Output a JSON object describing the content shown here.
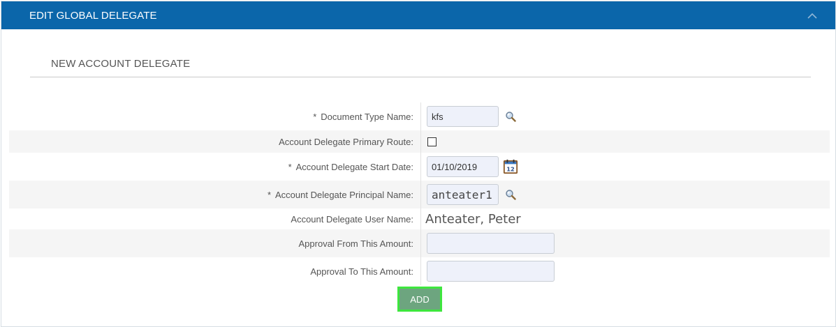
{
  "panel": {
    "title": "EDIT GLOBAL DELEGATE",
    "collapse_icon": "chevron-up-icon"
  },
  "section": {
    "title": "NEW ACCOUNT DELEGATE"
  },
  "fields": {
    "document_type": {
      "required_mark": "*",
      "label": "Document Type Name:",
      "value": "kfs",
      "lookup_icon": "search-icon"
    },
    "primary_route": {
      "label": "Account Delegate Primary Route:",
      "checked": false
    },
    "start_date": {
      "required_mark": "*",
      "label": "Account Delegate Start Date:",
      "value": "01/10/2019",
      "calendar_icon": "calendar-icon",
      "calendar_day": "12"
    },
    "principal_name": {
      "required_mark": "*",
      "label": "Account Delegate Principal Name:",
      "value": "anteater1",
      "lookup_icon": "search-icon"
    },
    "user_name": {
      "label": "Account Delegate User Name:",
      "value": "Anteater, Peter"
    },
    "approval_from": {
      "label": "Approval From This Amount:",
      "value": ""
    },
    "approval_to": {
      "label": "Approval To This Amount:",
      "value": ""
    }
  },
  "actions": {
    "add_label": "ADD"
  },
  "colors": {
    "header": "#0b66aa",
    "add_button": "#6da57f",
    "focus_outline": "#3ee63e"
  }
}
